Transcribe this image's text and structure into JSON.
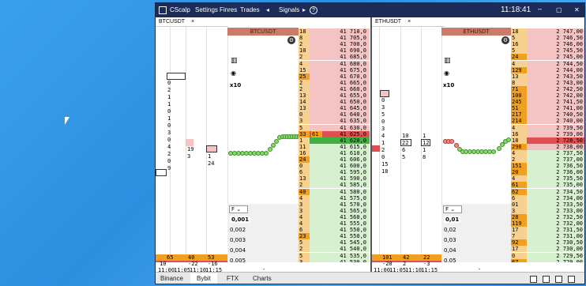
{
  "app": {
    "name": "CScalp",
    "menu": [
      "Settings",
      "Finres",
      "Trades"
    ],
    "signals": "Signals",
    "clock": "11:18:41",
    "help": "?"
  },
  "colors": {
    "titlebar": "#1c2b57",
    "ask_bg": "#f4c4c4",
    "bid_bg": "#d6f0d0",
    "highlight_ask": "#e05050",
    "highlight_bid": "#40b040",
    "orange": "#f0a020",
    "header_red": "#c97c6a"
  },
  "left": {
    "tab": "BTCUSDT",
    "close": "×",
    "header": "BTCUSDT",
    "multiplier": "x10",
    "cluster_col1": [
      "35",
      "0",
      "2",
      "1",
      "1",
      "0",
      "1",
      "0",
      "3",
      "0",
      "4",
      "2",
      "0",
      "9"
    ],
    "cluster_col2": [
      "18",
      "19",
      "3"
    ],
    "cluster_col3": [
      "16",
      "1",
      "24"
    ],
    "cluster_big": "36",
    "fselect": "F",
    "sizes": [
      "0,001",
      "0,002",
      "0,003",
      "0,004",
      "0,005"
    ],
    "stats": {
      "a": "65",
      "b": "40",
      "c": "53",
      "d": "10",
      "e": "-22",
      "f": "-16"
    },
    "times": [
      "11:00",
      "11:05",
      "11:10",
      "11:15"
    ],
    "dash": "-",
    "asks": [
      {
        "v": "18",
        "p": "41 710,0"
      },
      {
        "v": "8",
        "p": "41 705,0"
      },
      {
        "v": "2",
        "p": "41 700,0"
      },
      {
        "v": "10",
        "p": "41 690,0"
      },
      {
        "v": "2",
        "p": "41 685,0"
      },
      {
        "v": "4",
        "p": "41 680,0"
      },
      {
        "v": "15",
        "p": "41 675,0"
      },
      {
        "v": "25",
        "p": "41 670,0"
      },
      {
        "v": "2",
        "p": "41 665,0"
      },
      {
        "v": "2",
        "p": "41 660,0"
      },
      {
        "v": "13",
        "p": "41 655,0"
      },
      {
        "v": "14",
        "p": "41 650,0"
      },
      {
        "v": "13",
        "p": "41 645,0"
      },
      {
        "v": "0",
        "p": "41 640,0"
      },
      {
        "v": "3",
        "p": "41 635,0"
      },
      {
        "v": "5",
        "p": "41 630,0"
      },
      {
        "v": "33",
        "p": "41 625,0",
        "extra": "61"
      }
    ],
    "bids": [
      {
        "v": "1",
        "p": "41 620,0"
      },
      {
        "v": "11",
        "p": "41 615,0"
      },
      {
        "v": "16",
        "p": "41 610,0"
      },
      {
        "v": "24",
        "p": "41 606,0"
      },
      {
        "v": "0",
        "p": "41 600,0"
      },
      {
        "v": "6",
        "p": "41 595,0"
      },
      {
        "v": "13",
        "p": "41 590,0"
      },
      {
        "v": "2",
        "p": "41 585,0"
      },
      {
        "v": "40",
        "p": "41 580,0"
      },
      {
        "v": "4",
        "p": "41 575,0"
      },
      {
        "v": "3",
        "p": "41 570,0"
      },
      {
        "v": "3",
        "p": "41 565,0"
      },
      {
        "v": "4",
        "p": "41 560,0"
      },
      {
        "v": "4",
        "p": "41 555,0"
      },
      {
        "v": "6",
        "p": "41 550,0"
      },
      {
        "v": "23",
        "p": "41 550,0"
      },
      {
        "v": "5",
        "p": "41 545,0"
      },
      {
        "v": "2",
        "p": "41 540,0"
      },
      {
        "v": "5",
        "p": "41 535,0"
      },
      {
        "v": "3",
        "p": "41 530,0"
      },
      {
        "v": "3",
        "p": "41 525,0"
      }
    ]
  },
  "right": {
    "tab": "ETHUSDT",
    "close": "×",
    "header": "ETHUSDT",
    "multiplier": "x10",
    "cluster_col1": [
      "35",
      "0",
      "3",
      "5",
      "0",
      "3",
      "4",
      "1",
      "2",
      "0",
      "15",
      "18"
    ],
    "cluster_col2": [
      "10",
      "22",
      "6",
      "5"
    ],
    "cluster_col3": [
      "1",
      "12",
      "1",
      "8"
    ],
    "fselect": "F",
    "sizes": [
      "0,01",
      "0,02",
      "0,03",
      "0,04",
      "0,05"
    ],
    "stats": {
      "a": "101",
      "b": "42",
      "c": "22",
      "d": "-20",
      "e": "2",
      "f": "-3"
    },
    "times": [
      "11:00",
      "11:05",
      "11:10",
      "11:15"
    ],
    "dash": "-",
    "asks": [
      {
        "v": "18",
        "p": "2 747,00"
      },
      {
        "v": "5",
        "p": "2 746,50"
      },
      {
        "v": "16",
        "p": "2 746,00"
      },
      {
        "v": "5",
        "p": "2 745,50"
      },
      {
        "v": "24",
        "p": "2 745,00"
      },
      {
        "v": "4",
        "p": "2 744,50"
      },
      {
        "v": "129",
        "p": "2 744,00"
      },
      {
        "v": "13",
        "p": "2 743,50"
      },
      {
        "v": "8",
        "p": "2 743,00"
      },
      {
        "v": "71",
        "p": "2 742,50"
      },
      {
        "v": "100",
        "p": "2 742,00"
      },
      {
        "v": "245",
        "p": "2 741,50"
      },
      {
        "v": "51",
        "p": "2 741,00"
      },
      {
        "v": "217",
        "p": "2 740,50"
      },
      {
        "v": "214",
        "p": "2 740,00"
      },
      {
        "v": "4",
        "p": "2 739,50"
      },
      {
        "v": "16",
        "p": "2 739,00"
      },
      {
        "v": "18",
        "p": "2 728,50"
      },
      {
        "v": "296",
        "p": "2 738,00"
      }
    ],
    "bids": [
      {
        "v": "4",
        "p": "2 737,50"
      },
      {
        "v": "2",
        "p": "2 737,00"
      },
      {
        "v": "151",
        "p": "2 736,50"
      },
      {
        "v": "20",
        "p": "2 736,00"
      },
      {
        "v": "4",
        "p": "2 735,50"
      },
      {
        "v": "61",
        "p": "2 735,00"
      },
      {
        "v": "62",
        "p": "2 734,50"
      },
      {
        "v": "6",
        "p": "2 734,00"
      },
      {
        "v": "01",
        "p": "2 733,50"
      },
      {
        "v": "3",
        "p": "2 733,00"
      },
      {
        "v": "28",
        "p": "2 732,50"
      },
      {
        "v": "119",
        "p": "2 732,00"
      },
      {
        "v": "17",
        "p": "2 731,50"
      },
      {
        "v": "7",
        "p": "2 731,00"
      },
      {
        "v": "92",
        "p": "2 730,50"
      },
      {
        "v": "17",
        "p": "2 730,00"
      },
      {
        "v": "0",
        "p": "2 729,50"
      },
      {
        "v": "67",
        "p": "2 729,00"
      },
      {
        "v": "2",
        "p": "2 728,50"
      },
      {
        "v": "27",
        "p": "2 728,00"
      },
      {
        "v": "20",
        "p": "2 727,50"
      }
    ]
  },
  "bottom_tabs": [
    "Binance",
    "Bybit",
    "FTX",
    "Charts"
  ]
}
